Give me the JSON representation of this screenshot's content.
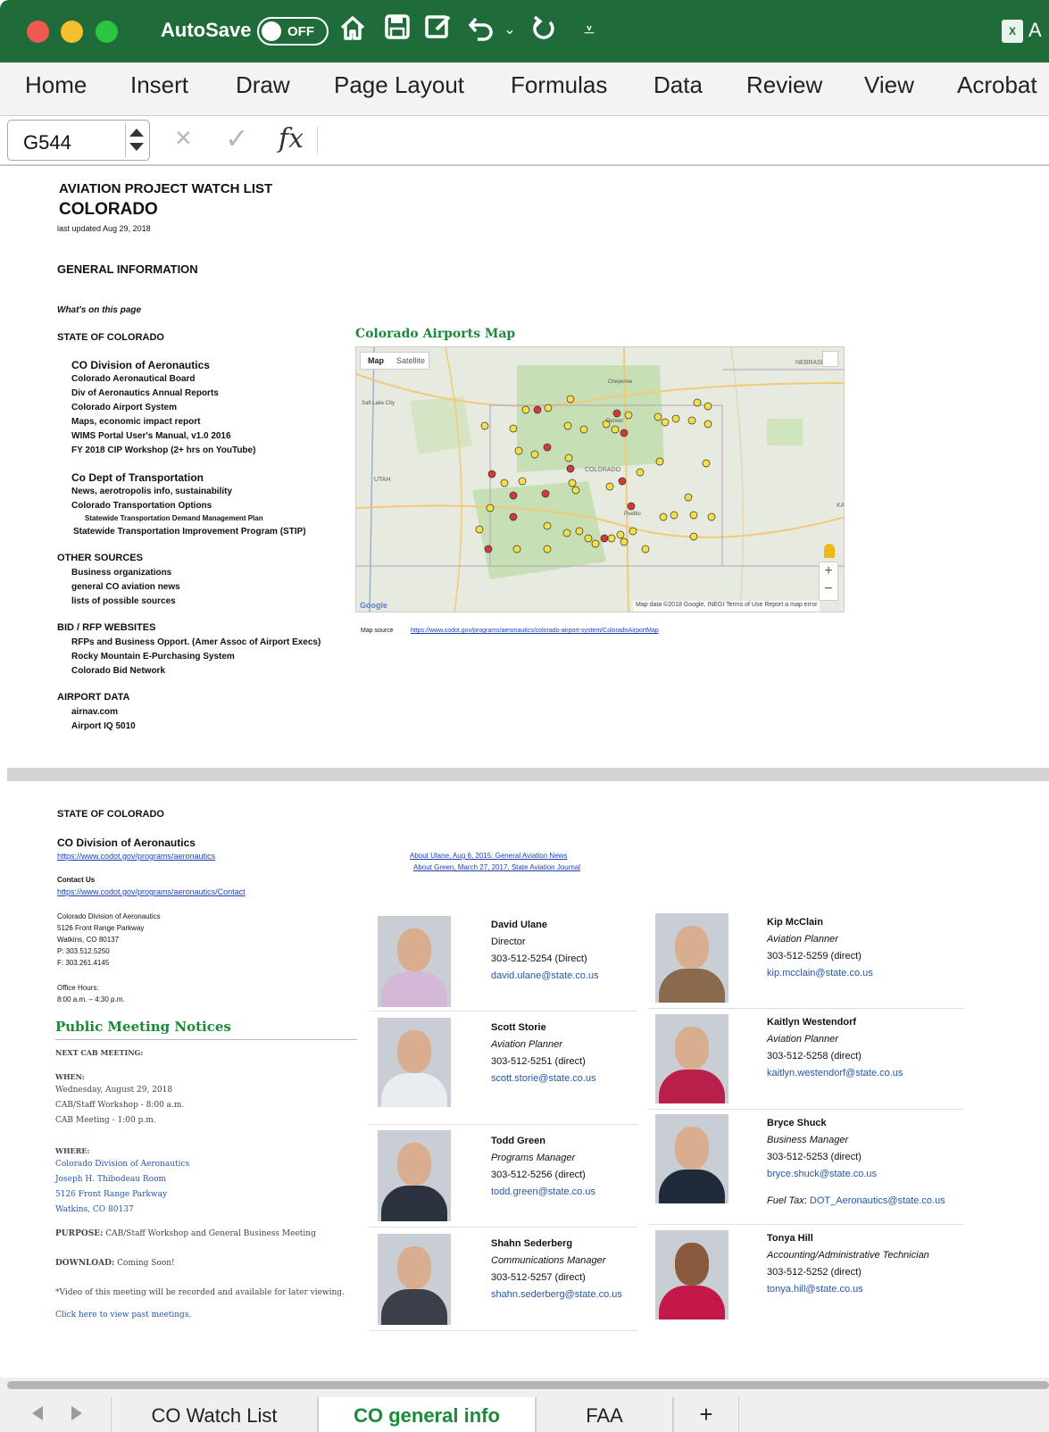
{
  "titlebar": {
    "autosave_label": "AutoSave",
    "autosave_state": "OFF",
    "title_fragment": "A",
    "app_icon": "excel-icon",
    "quick_access_icons": [
      "home-icon",
      "save-icon",
      "edit-icon",
      "undo-icon",
      "chevron-down-icon",
      "redo-icon",
      "customize-icon"
    ],
    "bg_color": "#1f6b3a"
  },
  "ribbon": {
    "tabs": [
      "Home",
      "Insert",
      "Draw",
      "Page Layout",
      "Formulas",
      "Data",
      "Review",
      "View",
      "Acrobat"
    ]
  },
  "formula_bar": {
    "name_box": "G544",
    "cancel_glyph": "×",
    "enter_glyph": "✓",
    "fx_glyph": "fx",
    "formula": ""
  },
  "sheet": {
    "header": {
      "watch_title": "AVIATION PROJECT WATCH LIST",
      "state": "COLORADO",
      "updated": "last updated Aug 29, 2018",
      "general_info": "GENERAL INFORMATION",
      "whats_on": "What's on this page"
    },
    "toc": {
      "state_heading": "STATE OF COLORADO",
      "division_heading": "CO Division of Aeronautics",
      "division_items": [
        "Colorado Aeronautical Board",
        "Div of Aeronautics Annual Reports",
        "Colorado Airport System",
        "Maps, economic impact report",
        "WIMS Portal User's Manual, v1.0 2016",
        "FY 2018 CIP Workshop (2+ hrs on YouTube)"
      ],
      "transport_heading": "Co Dept of Transportation",
      "transport_items": [
        "News, aerotropolis info, sustainability",
        "Colorado Transportation Options"
      ],
      "transport_sub": "Statewide Transportation Demand Management Plan",
      "transport_stip": "Statewide Transportation Improvement Program (STIP)",
      "other_heading": "OTHER SOURCES",
      "other_items": [
        "Business organizations",
        "general CO aviation news",
        "lists of possible sources"
      ],
      "bid_heading": "BID / RFP WEBSITES",
      "bid_items": [
        "RFPs and Business Opport. (Amer Assoc of Airport Execs)",
        "Rocky Mountain E-Purchasing System",
        "Colorado Bid Network"
      ],
      "airport_heading": "AIRPORT DATA",
      "airport_items": [
        "airnav.com",
        "Airport IQ 5010"
      ]
    },
    "map": {
      "title": "Colorado Airports Map",
      "btn_map": "Map",
      "btn_satellite": "Satellite",
      "attribution": "Map data ©2018 Google, INEGI   Terms of Use   Report a map error",
      "logo": "Google",
      "source_label": "Map source",
      "source_url": "https://www.codot.gov/programs/aeronautics/colorado-airport-system/ColoradoAirportMap",
      "zoom_in": "+",
      "zoom_out": "−",
      "place_labels": [
        "NEBRASKA",
        "UTAH",
        "Salt Lake City",
        "COLORADO",
        "Cheyenne",
        "Denver",
        "Pueblo",
        "KA"
      ]
    },
    "section2": {
      "state_heading": "STATE OF COLORADO",
      "division_heading": "CO Division of Aeronautics",
      "division_url": "https://www.codot.gov/programs/aeronautics",
      "contact_heading": "Contact Us",
      "contact_url": "https://www.codot.gov/programs/aeronautics/Contact",
      "address_lines": [
        "Colorado Division of Aeronautics",
        "5126 Front Range Parkway",
        "Watkins, CO 80137",
        "P: 303.512.5250",
        "F: 303.261.4145"
      ],
      "office_hours_label": "Office Hours:",
      "office_hours": "8:00 a.m. – 4:30 p.m.",
      "about_links": [
        "About Ulane, Aug 6, 2015: General Aviation News",
        "About Green, March 27, 2017, State Aviation Journal"
      ]
    },
    "meetings": {
      "title": "Public Meeting Notices",
      "next": "NEXT CAB MEETING:",
      "when_label": "WHEN:",
      "when_lines": [
        "Wednesday, August 29, 2018",
        "CAB/Staff Workshop - 8:00 a.m.",
        "CAB Meeting - 1:00 p.m."
      ],
      "where_label": "WHERE:",
      "where_lines": [
        "Colorado Division of Aeronautics",
        "Joseph H. Thibodeau Room",
        "5126 Front Range Parkway",
        "Watkins, CO 80137"
      ],
      "purpose_label": "PURPOSE:",
      "purpose": " CAB/Staff Workshop and General Business Meeting",
      "download_label": "DOWNLOAD:",
      "download": " Coming Soon!",
      "video_note": "*Video of this meeting will be recorded and available for later viewing.",
      "past_link": "Click here to view past meetings."
    },
    "staff": [
      {
        "name": "David Ulane",
        "title": "Director",
        "phone": "303-512-5254 (Direct)",
        "email": "david.ulane@state.co.us",
        "shirt": "#d5b8d8"
      },
      {
        "name": "Scott Storie",
        "title": "Aviation Planner",
        "phone": "303-512-5251 (direct)",
        "email": "scott.storie@state.co.us",
        "shirt": "#e9ecf0"
      },
      {
        "name": "Todd Green",
        "title": "Programs Manager",
        "phone": "303-512-5256 (direct)",
        "email": "todd.green@state.co.us",
        "shirt": "#2c3340"
      },
      {
        "name": "Shahn Sederberg",
        "title": "Communications Manager",
        "phone": "303-512-5257 (direct)",
        "email": "shahn.sederberg@state.co.us",
        "shirt": "#3a3f4a"
      },
      {
        "name": "Kip McClain",
        "title": "Aviation Planner",
        "phone": "303-512-5259 (direct)",
        "email": "kip.mcclain@state.co.us",
        "shirt": "#8a6a4c"
      },
      {
        "name": "Kaitlyn Westendorf",
        "title": "Aviation Planner",
        "phone": "303-512-5258 (direct)",
        "email": "kaitlyn.westendorf@state.co.us",
        "shirt": "#b8204a"
      },
      {
        "name": "Bryce Shuck",
        "title": "Business Manager",
        "phone": "303-512-5253 (direct)",
        "email": "bryce.shuck@state.co.us",
        "shirt": "#1f2a3a"
      },
      {
        "name": "Tonya Hill",
        "title": "Accounting/Administrative Technician",
        "phone": "303-512-5252 (direct)",
        "email": "tonya.hill@state.co.us",
        "shirt": "#c4184a"
      }
    ],
    "fuel_tax_label": "Fuel Tax",
    "fuel_tax_email": "DOT_Aeronautics@state.co.us"
  },
  "sheet_tabs": {
    "tabs": [
      "CO Watch List",
      "CO general info",
      "FAA"
    ],
    "active": "CO general info",
    "add": "+"
  }
}
